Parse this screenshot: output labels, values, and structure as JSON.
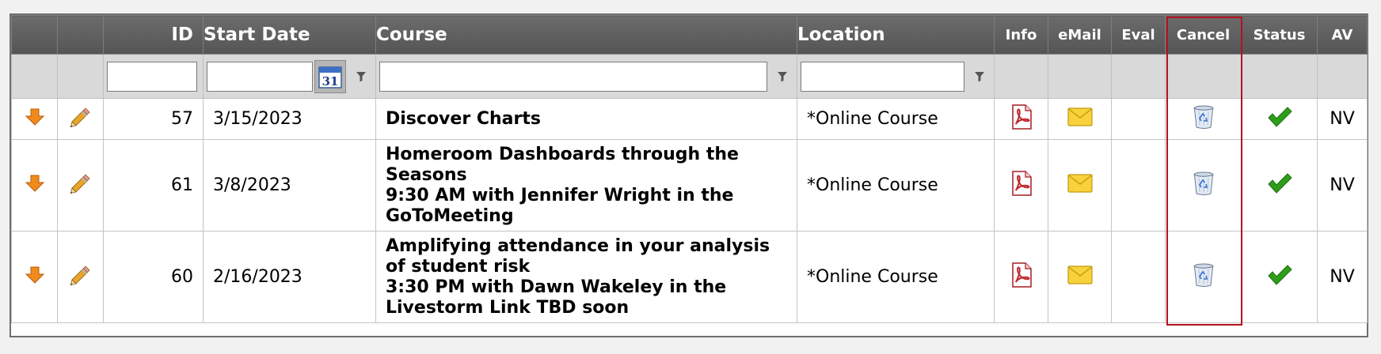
{
  "columns": {
    "id": "ID",
    "start_date": "Start Date",
    "course": "Course",
    "location": "Location",
    "info": "Info",
    "email": "eMail",
    "eval": "Eval",
    "cancel": "Cancel",
    "status": "Status",
    "av": "AV"
  },
  "filters": {
    "id": "",
    "start_date": "",
    "course": "",
    "location": ""
  },
  "calendar_label": "31",
  "rows": [
    {
      "id": "57",
      "start_date": "3/15/2023",
      "course_lines": [
        "Discover Charts"
      ],
      "location": "*Online Course",
      "av": "NV"
    },
    {
      "id": "61",
      "start_date": "3/8/2023",
      "course_lines": [
        "Homeroom Dashboards through the",
        "Seasons",
        "9:30 AM with Jennifer Wright in the",
        "GoToMeeting"
      ],
      "location": "*Online Course",
      "av": "NV"
    },
    {
      "id": "60",
      "start_date": "2/16/2023",
      "course_lines": [
        "Amplifying attendance in your analysis",
        "of student risk",
        "3:30 PM with Dawn Wakeley in the",
        "Livestorm Link TBD soon"
      ],
      "location": "*Online Course",
      "av": "NV"
    }
  ],
  "icons": {
    "move": "arrow-down-icon",
    "edit": "pencil-icon",
    "info": "pdf-icon",
    "email": "envelope-icon",
    "cancel": "recycle-bin-icon",
    "status": "checkmark-icon",
    "filter": "funnel-icon",
    "calendar": "calendar-icon"
  },
  "colors": {
    "header_bg": "#5e5e5e",
    "filter_bg": "#d9d9d9",
    "highlight_border": "#b3121f",
    "arrow": "#f08a1c",
    "check": "#2e9e1a",
    "envelope": "#f7d23b",
    "pdf": "#c0282d"
  }
}
